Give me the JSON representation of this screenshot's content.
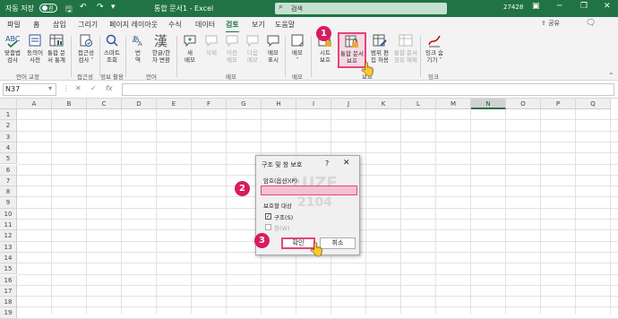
{
  "titlebar": {
    "autosave_label": "자동 저장",
    "autosave_state": "끔",
    "doc_title": "통합 문서1  -  Excel",
    "search_placeholder": "검색",
    "user": "27428"
  },
  "menu": {
    "tabs": [
      "파일",
      "홈",
      "삽입",
      "그리기",
      "페이지 레이아웃",
      "수식",
      "데이터",
      "검토",
      "보기",
      "도움말"
    ],
    "active": "검토",
    "share_label": "공유"
  },
  "ribbon": {
    "buttons": {
      "spelling": "맞춤법\n검사",
      "thesaurus": "동의어\n사전",
      "workbook_stats": "통합 문\n서 통계",
      "accessibility": "접근성\n검사 ˅",
      "smart_lookup": "스마트\n조회",
      "translate": "번\n역",
      "korean_hanja": "한글/한\n자 변환",
      "new_comment": "새\n메모",
      "delete_comment": "삭제",
      "prev_comment": "이전\n메모",
      "next_comment": "다음\n메모",
      "show_comments": "메모\n표시",
      "notes": "메모\n˅",
      "protect_sheet": "시트\n보호",
      "protect_workbook": "통합 문서\n보호",
      "allow_edit_ranges": "범위 편\n집 허용",
      "unshare_workbook": "통합 문서\n공유 해제",
      "hide_ink": "잉크 숨\n기기 ˅"
    },
    "groups": {
      "proofing": "언어 교정",
      "accessibility": "접근성",
      "insights": "정보 활용",
      "language": "언어",
      "comments": "메모",
      "notes": "메모",
      "protect": "보호",
      "ink": "잉크"
    }
  },
  "formulabar": {
    "namebox": "N37"
  },
  "grid": {
    "columns": [
      "A",
      "B",
      "C",
      "D",
      "E",
      "F",
      "G",
      "H",
      "I",
      "J",
      "K",
      "L",
      "M",
      "N",
      "O",
      "P",
      "Q"
    ],
    "selected_column": "N",
    "rows": [
      "1",
      "2",
      "3",
      "4",
      "5",
      "6",
      "7",
      "8",
      "9",
      "10",
      "11",
      "12",
      "13",
      "14",
      "15",
      "16",
      "17",
      "18",
      "19"
    ]
  },
  "dialog": {
    "title": "구조 및 창 보호",
    "help": "?",
    "close": "✕",
    "password_label": "암호(옵션)(P):",
    "password_value": "",
    "target_label": "보호할 대상",
    "structure_label": "구조(S)",
    "structure_checked": true,
    "windows_label": "창(W)",
    "windows_checked": false,
    "ok_label": "확인",
    "cancel_label": "취소",
    "watermark_1": "LUZE",
    "watermark_2": "2104"
  },
  "annotations": [
    "1",
    "2",
    "3"
  ],
  "colors": {
    "excel_green": "#217346",
    "highlight_pink": "#e3457b",
    "badge_magenta": "#d81b60"
  }
}
